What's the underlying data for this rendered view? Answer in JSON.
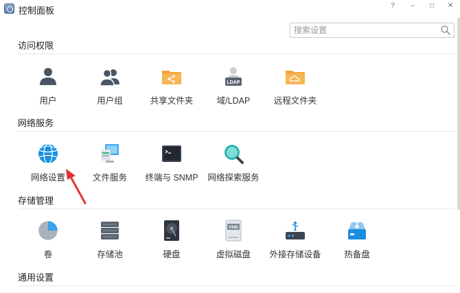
{
  "window": {
    "title": "控制面板",
    "help": "?",
    "minimize": "–",
    "maximize": "□",
    "close": "✕"
  },
  "search": {
    "placeholder": "搜索设置"
  },
  "sections": {
    "access": {
      "title": "访问权限",
      "items": [
        {
          "label": "用户",
          "icon": "user-icon"
        },
        {
          "label": "用户组",
          "icon": "user-group-icon"
        },
        {
          "label": "共享文件夹",
          "icon": "shared-folder-icon"
        },
        {
          "label": "域/LDAP",
          "icon": "ldap-icon"
        },
        {
          "label": "远程文件夹",
          "icon": "remote-folder-icon"
        }
      ]
    },
    "network": {
      "title": "网络服务",
      "items": [
        {
          "label": "网络设置",
          "icon": "globe-icon"
        },
        {
          "label": "文件服务",
          "icon": "file-service-icon"
        },
        {
          "label": "终端与 SNMP",
          "icon": "terminal-icon"
        },
        {
          "label": "网络探索服务",
          "icon": "discovery-icon"
        }
      ]
    },
    "storage": {
      "title": "存储管理",
      "items": [
        {
          "label": "卷",
          "icon": "volume-pie-icon"
        },
        {
          "label": "存储池",
          "icon": "storage-pool-icon"
        },
        {
          "label": "硬盘",
          "icon": "hard-disk-icon"
        },
        {
          "label": "虚拟磁盘",
          "icon": "virtual-disk-icon",
          "badge": "VHD"
        },
        {
          "label": "外接存储设备",
          "icon": "usb-storage-icon"
        },
        {
          "label": "热备盘",
          "icon": "hot-spare-icon"
        }
      ]
    },
    "general": {
      "title": "通用设置"
    }
  },
  "ldap_badge": "LDAP",
  "colors": {
    "accent_orange": "#f5a13a",
    "accent_blue": "#1a8fe0",
    "icon_gray": "#4a5563",
    "arrow_red": "#e63232"
  }
}
